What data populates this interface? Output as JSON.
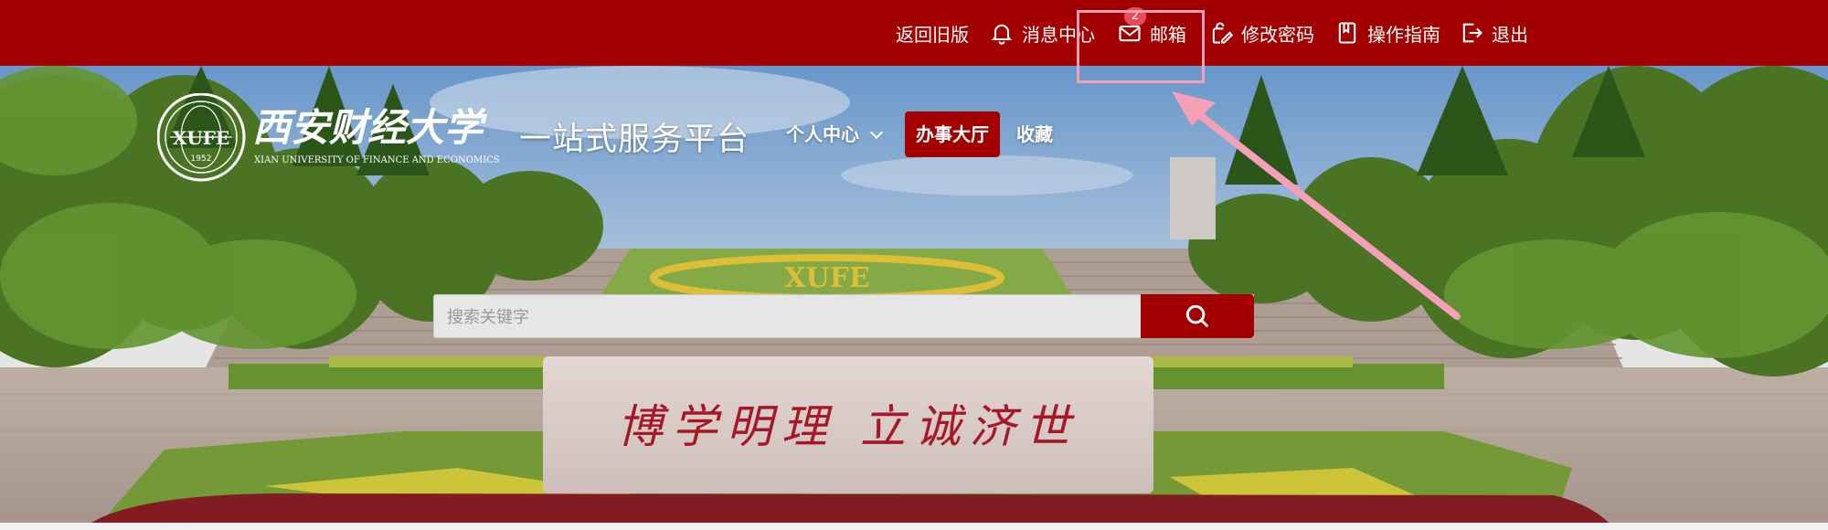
{
  "topbar": {
    "items": [
      {
        "label": "返回旧版",
        "icon": ""
      },
      {
        "label": "消息中心",
        "icon": "bell-icon"
      },
      {
        "label": "邮箱",
        "icon": "mail-icon",
        "badge": "2"
      },
      {
        "label": "修改密码",
        "icon": "edit-lock-icon"
      },
      {
        "label": "操作指南",
        "icon": "book-icon"
      },
      {
        "label": "退出",
        "icon": "logout-icon"
      }
    ]
  },
  "header": {
    "logo": {
      "name_cn": "西安财经大学",
      "name_en": "XIAN UNIVERSITY OF FINANCE AND ECONOMICS",
      "seal_text": "XUFE",
      "seal_year": "1952"
    },
    "platform_title": "一站式服务平台",
    "nav": [
      {
        "label": "个人中心",
        "has_dropdown": true
      },
      {
        "label": "办事大厅",
        "active": true
      },
      {
        "label": "收藏"
      }
    ]
  },
  "search": {
    "placeholder": "搜索关键字",
    "value": ""
  },
  "banner": {
    "motto": "博学明理 立诚济世",
    "flowerbed_text": "XUFE"
  },
  "colors": {
    "brand": "#a20000",
    "annotation": "#f4a0b8"
  }
}
